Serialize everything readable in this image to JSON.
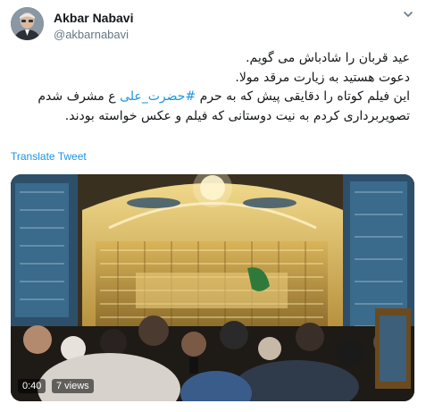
{
  "author": {
    "display_name": "Akbar Nabavi",
    "handle": "@akbarnabavi"
  },
  "tweet": {
    "lines": [
      {
        "text": "عید قربان را شادباش می گویم.",
        "hashtag": null
      },
      {
        "text": "دعوت هستید به زیارت مرقد مولا.",
        "hashtag": null
      },
      {
        "before": "این فیلم کوتاه را دقایقی پیش که به حرم ",
        "hashtag": "#حضرت_علی",
        "after": " ع مشرف شدم"
      },
      {
        "text": "تصویربرداری کردم به نیت دوستانی که فیلم و عکس خواسته بودند.",
        "hashtag": null
      }
    ],
    "translate_label": "Translate Tweet"
  },
  "media": {
    "timecode": "0:40",
    "views": "7 views"
  },
  "icons": {
    "more": "chevron-down-icon",
    "avatar": "profile-photo"
  },
  "colors": {
    "link": "#1b95e0",
    "text": "#14171a",
    "secondary": "#657786"
  }
}
